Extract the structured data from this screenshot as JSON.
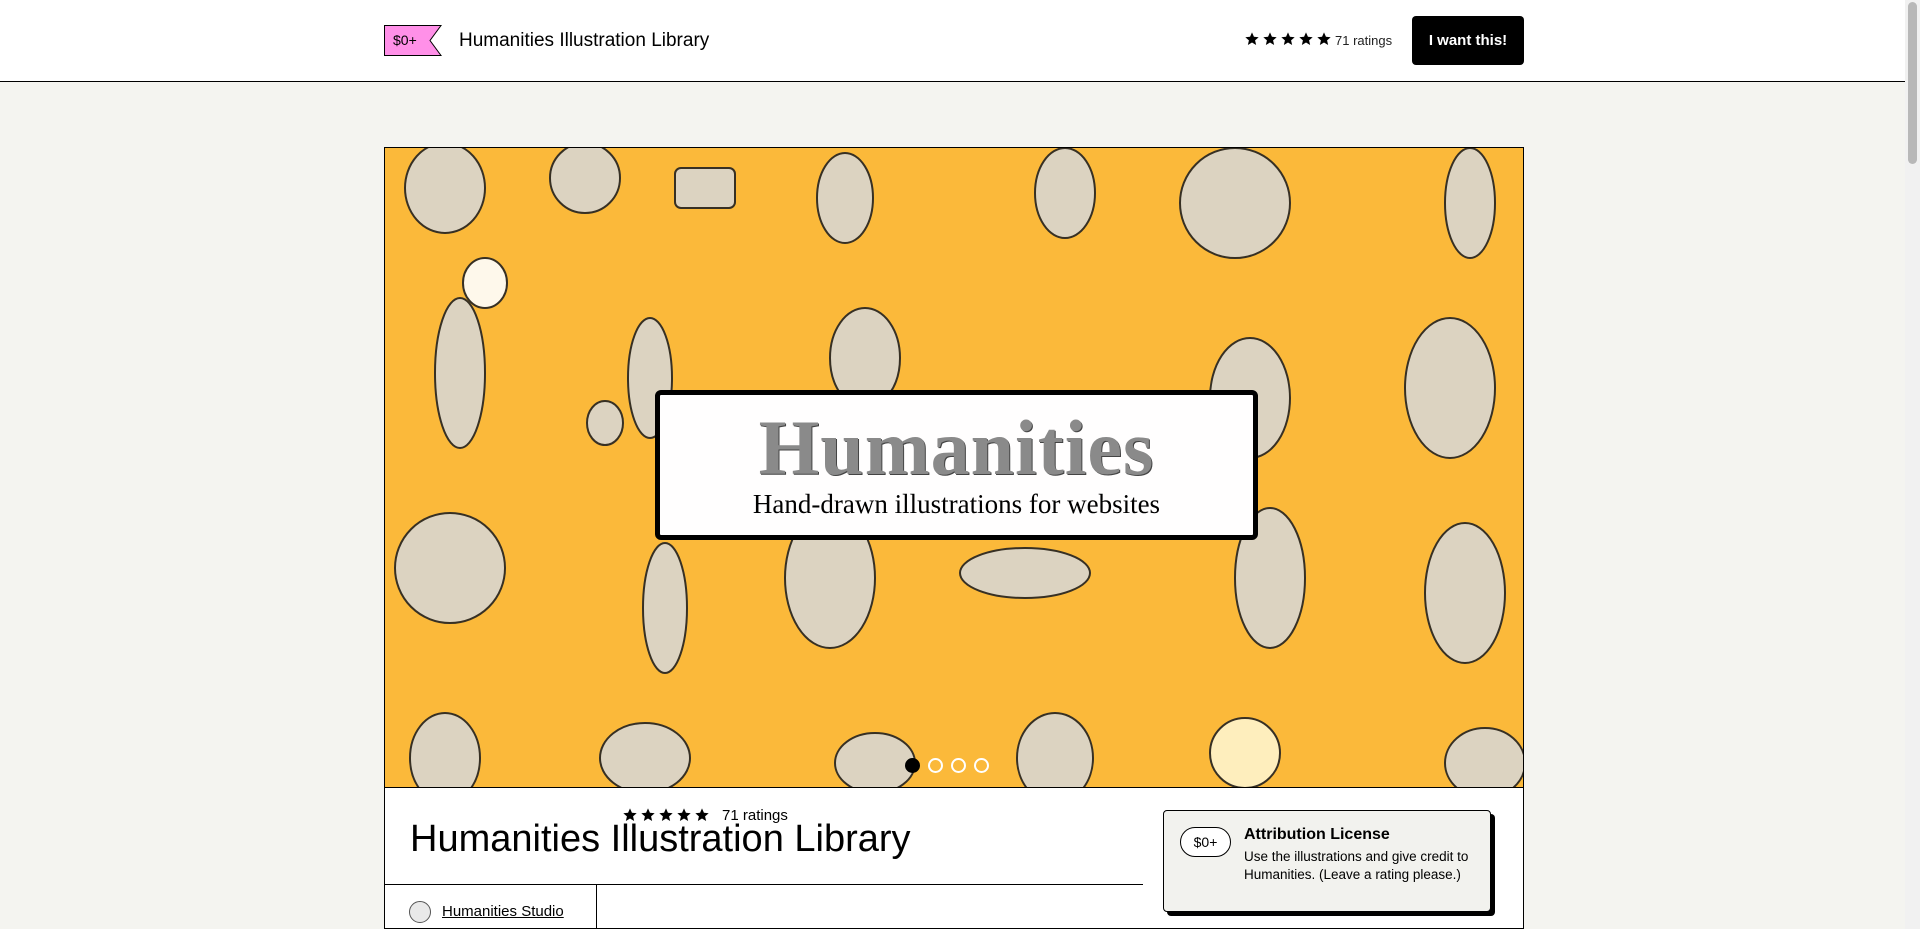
{
  "header": {
    "price_tag": "$0+",
    "title": "Humanities Illustration Library",
    "rating_stars": 5,
    "ratings_label": "71 ratings",
    "cta_label": "I want this!"
  },
  "hero": {
    "title": "Humanities",
    "subtitle": "Hand-drawn illustrations for websites",
    "slides": 4,
    "active_slide": 1,
    "background_color": "#fbb93a"
  },
  "product": {
    "title": "Humanities Illustration Library",
    "creator": "Humanities Studio",
    "rating_stars": 5,
    "ratings_label": "71 ratings"
  },
  "license": {
    "price": "$0+",
    "name": "Attribution License",
    "description": "Use the illustrations and give credit to Humanities. (Leave a rating please.)"
  },
  "colors": {
    "accent_pink": "#ff90e8",
    "button_bg": "#000000",
    "page_bg": "#f4f4f0"
  },
  "icons": {
    "star": "star-icon",
    "tag": "price-tag-icon",
    "avatar": "creator-avatar"
  }
}
